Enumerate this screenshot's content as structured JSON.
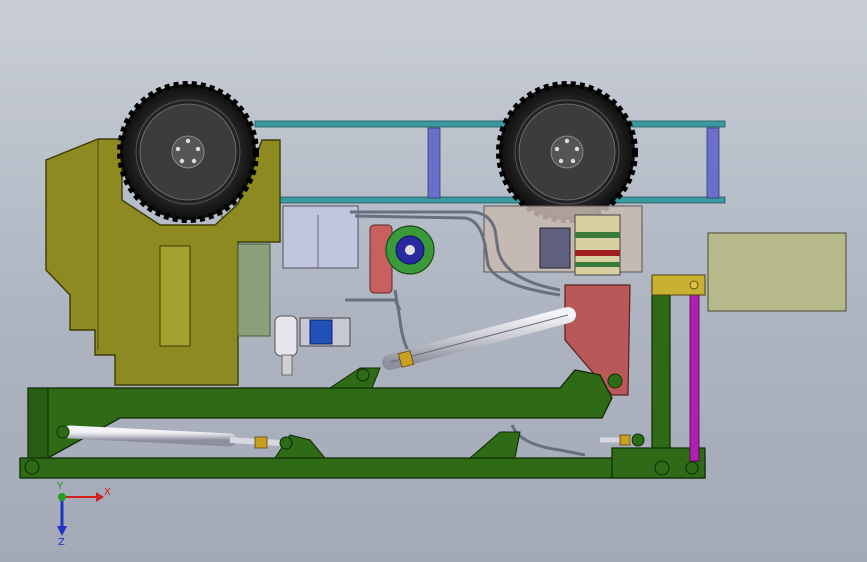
{
  "viewport": {
    "background_top": "#c9ced6",
    "background_bottom": "#a3a9b6"
  },
  "axis_triad": {
    "x_label": "X",
    "y_label": "Y",
    "z_label": "Z",
    "x_color": "#d62020",
    "y_color": "#20a020",
    "z_color": "#2030c8"
  },
  "colors": {
    "frame_green": "#2f6b16",
    "cab_olive": "#8c8a20",
    "chassis_teal": "#3a9aa0",
    "post_blue": "#6a70c8",
    "bracket_red": "#b85858",
    "panel_khaki": "#b6b98a",
    "link_magenta": "#b020b0",
    "tire_black": "#1a1a1a",
    "cylinder_silver": "#dcdde4"
  }
}
